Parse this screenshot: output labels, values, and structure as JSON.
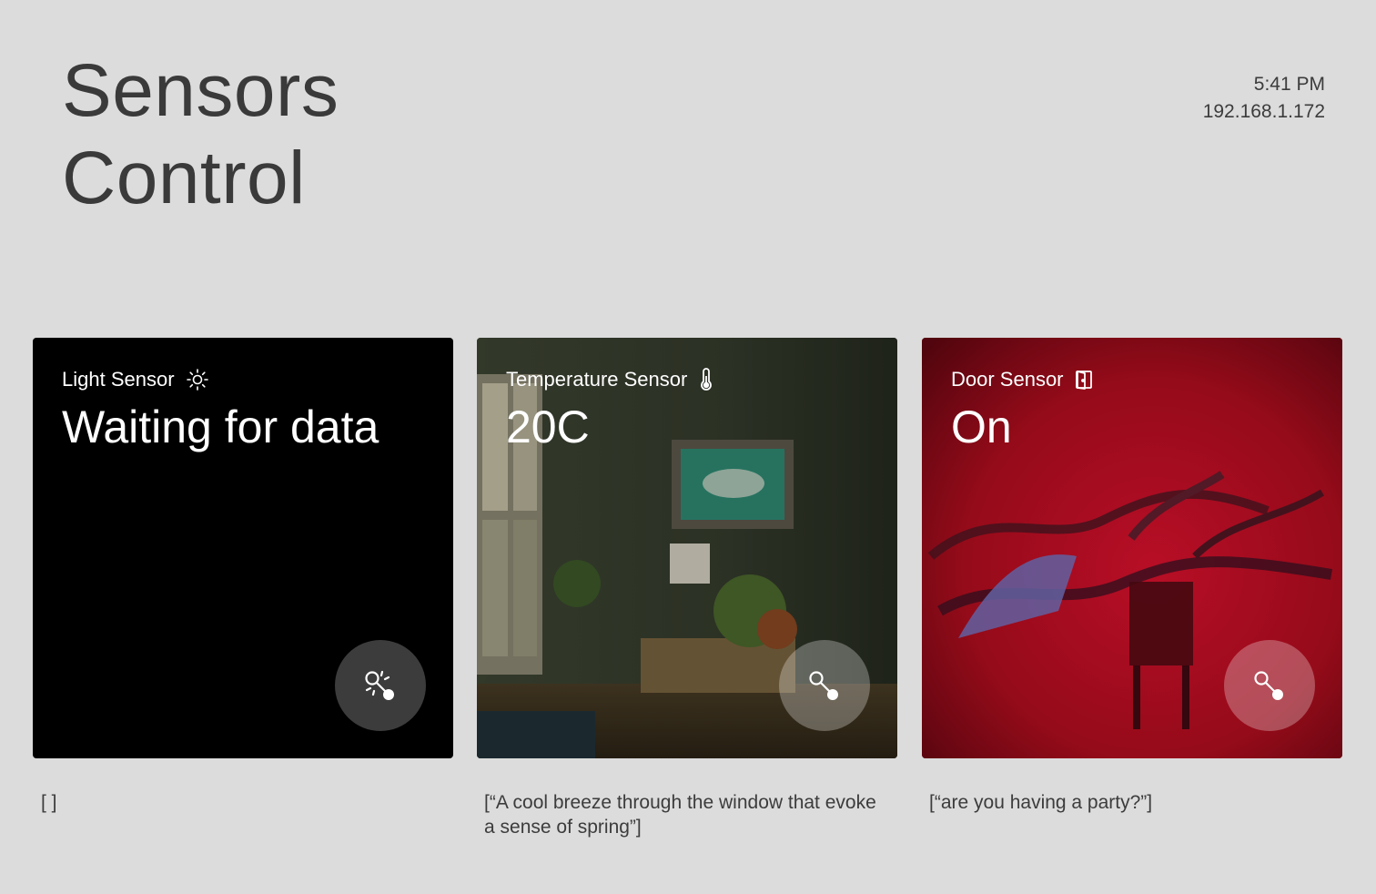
{
  "header": {
    "title_line1": "Sensors",
    "title_line2": "Control",
    "time": "5:41 PM",
    "ip_address": "192.168.1.172"
  },
  "cards": [
    {
      "label": "Light Sensor",
      "icon": "sun-icon",
      "value": "Waiting for data",
      "action_icon": "magic-wand-icon",
      "caption": "[ ]",
      "background": "#000000"
    },
    {
      "label": "Temperature Sensor",
      "icon": "thermometer-icon",
      "value": "20C",
      "action_icon": "wand-icon",
      "caption": "[“A cool breeze through the window that evoke a sense of spring”]",
      "background": "#2c3326"
    },
    {
      "label": "Door Sensor",
      "icon": "door-icon",
      "value": "On",
      "action_icon": "wand-icon",
      "caption": "[“are you having a party?”]",
      "background": "#8a0c14"
    }
  ]
}
